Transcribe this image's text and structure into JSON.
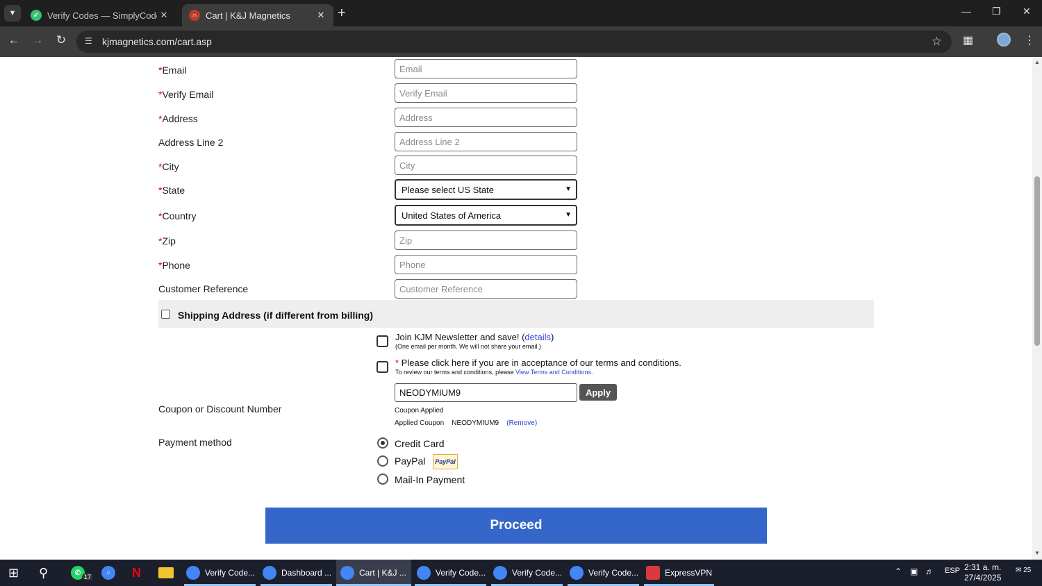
{
  "browser": {
    "tabs": [
      {
        "title": "Verify Codes — SimplyCodes",
        "favicon_color": "#38c172",
        "active": false
      },
      {
        "title": "Cart | K&J Magnetics",
        "favicon_color": "#c0392b",
        "active": true
      }
    ],
    "url": "kjmagnetics.com/cart.asp",
    "icons": [
      "tab-search-icon",
      "new-tab-icon",
      "minimize-icon",
      "restore-icon",
      "window-close-icon",
      "back-icon",
      "forward-icon",
      "reload-icon",
      "site-info-icon",
      "bookmark-star-icon",
      "extensions-icon",
      "profile-avatar-icon",
      "kebab-menu-icon"
    ]
  },
  "form": {
    "required_marker": "*",
    "fields": [
      {
        "label": "Email",
        "placeholder": "Email",
        "required": true
      },
      {
        "label": "Verify Email",
        "placeholder": "Verify Email",
        "required": true
      },
      {
        "label": "Address",
        "placeholder": "Address",
        "required": true
      },
      {
        "label": "Address Line 2",
        "placeholder": "Address Line 2",
        "required": false
      },
      {
        "label": "City",
        "placeholder": "City",
        "required": true
      }
    ],
    "state": {
      "label": "State",
      "value": "Please select US State"
    },
    "country": {
      "label": "Country",
      "value": "United States of America"
    },
    "fields2": [
      {
        "label": "Zip",
        "placeholder": "Zip",
        "required": true
      },
      {
        "label": "Phone",
        "placeholder": "Phone",
        "required": true
      },
      {
        "label": "Customer Reference",
        "placeholder": "Customer Reference",
        "required": false
      }
    ],
    "shipping_label": "Shipping Address (if different from billing)",
    "newsletter": {
      "text": "Join KJM Newsletter and save! (",
      "link": "details",
      "close": ")",
      "sub": "(One email per month. We will not share your email.)"
    },
    "terms": {
      "marker": "*",
      "text": " Please click here if you are in acceptance of our terms and conditions.",
      "sub": "To review our terms and conditions, please ",
      "link": "View Terms and Conditions",
      "period": "."
    },
    "coupon": {
      "label": "Coupon or Discount Number",
      "value": "NEODYMIUM9",
      "apply": "Apply",
      "applied": "Coupon Applied",
      "applied_prefix": "Applied Coupon",
      "applied_code": "NEODYMIUM9",
      "remove_open": "(",
      "remove": "Remove",
      "remove_close": ")"
    },
    "payment": {
      "label": "Payment method",
      "options": [
        {
          "label": "Credit Card",
          "selected": true
        },
        {
          "label": "PayPal",
          "selected": false
        },
        {
          "label": "Mail-In Payment",
          "selected": false
        }
      ],
      "paypal_badge": "PayPal"
    },
    "proceed": "Proceed"
  },
  "taskbar": {
    "items": [
      {
        "label": "Verify Code...",
        "color": "#4285f4"
      },
      {
        "label": "Dashboard ...",
        "color": "#4285f4"
      },
      {
        "label": "Cart | K&J ...",
        "color": "#4285f4",
        "active": true
      },
      {
        "label": "Verify Code...",
        "color": "#4285f4"
      },
      {
        "label": "Verify Code...",
        "color": "#4285f4"
      },
      {
        "label": "Verify Code...",
        "color": "#4285f4"
      },
      {
        "label": "ExpressVPN",
        "color": "#da3940"
      }
    ],
    "whatsapp_badge": "17",
    "language": "ESP",
    "time": "2:31 a. m.",
    "date": "27/4/2025",
    "notifications": "25"
  }
}
